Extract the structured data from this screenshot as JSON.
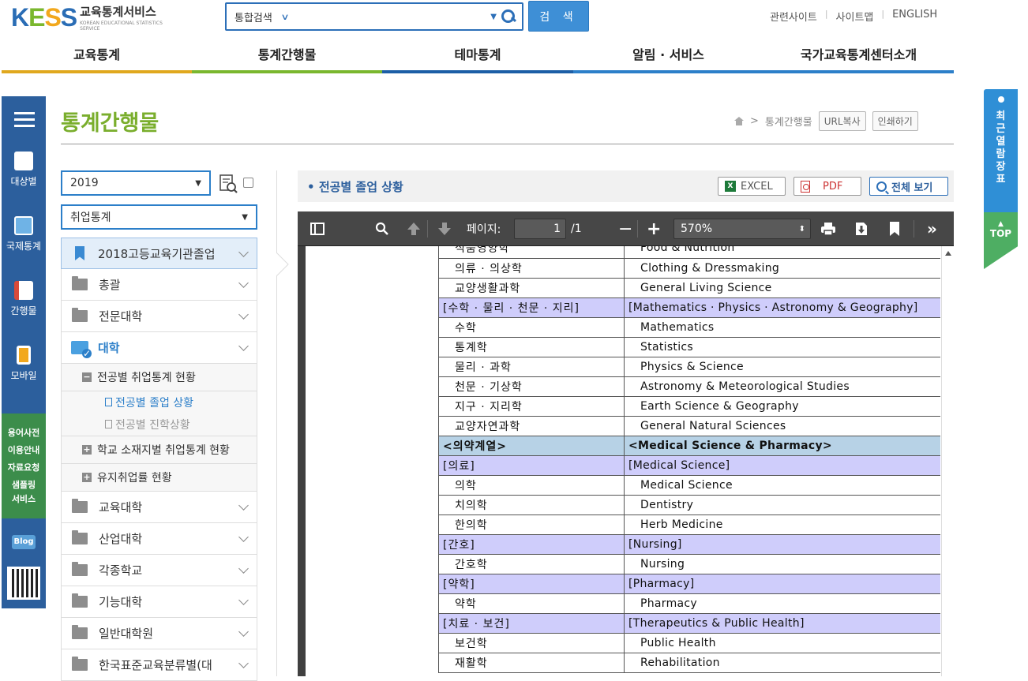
{
  "header": {
    "logo_main": "KESS",
    "logo_ko": "교육통계서비스",
    "logo_en": "KOREAN EDUCATIONAL STATISTICS SERVICE",
    "search_scope": "통합검색",
    "search_button": "검 색",
    "util_links": [
      "관련사이트",
      "사이트맵",
      "ENGLISH"
    ]
  },
  "gnb": {
    "items": [
      "교육통계",
      "통계간행물",
      "테마통계",
      "알림 · 서비스",
      "국가교육통계센터소개"
    ],
    "colors": [
      "#e0a81e",
      "#7ab72e",
      "#1c5ea6",
      "#2c7fc9",
      "#2c7fc9"
    ]
  },
  "quick_nav": {
    "items": [
      "대상별",
      "국제통계",
      "간행물",
      "모바일"
    ],
    "links": [
      "용어사전",
      "이용안내",
      "자료요청",
      "샘플링",
      "서비스"
    ],
    "blog": "Blog"
  },
  "sticky": {
    "recent": "최근열람장표",
    "top": "TOP"
  },
  "page": {
    "title": "통계간행물",
    "breadcrumb": "통계간행물",
    "url_copy": "URL복사",
    "print": "인쇄하기"
  },
  "filters": {
    "year": "2019",
    "category": "취업통계"
  },
  "tree": {
    "first": "2018고등교육기관졸업",
    "folders_top": [
      "총괄",
      "전문대학"
    ],
    "open_folder": "대학",
    "sub1": "전공별 취업통계 현황",
    "leaf1": "전공별 졸업 상황",
    "leaf2": "전공별 진학상황",
    "sub2": "학교 소재지별 취업통계 현황",
    "sub3": "유지취업률 현황",
    "folders_bottom": [
      "교육대학",
      "산업대학",
      "각종학교",
      "기능대학",
      "일반대학원",
      "한국표준교육분류별(대"
    ]
  },
  "viewer": {
    "title": "전공별 졸업 상황",
    "excel": "EXCEL",
    "pdf": "PDF",
    "full": "전체 보기",
    "page_label": "페이지:",
    "page_num": "1",
    "page_total": "/1",
    "zoom": "570%"
  },
  "table_rows": [
    {
      "ko": "식품영양학",
      "en": "Food & Nutrition",
      "type": "row"
    },
    {
      "ko": "의류 · 의상학",
      "en": "Clothing & Dressmaking",
      "type": "row"
    },
    {
      "ko": "교양생활과학",
      "en": "General Living Science",
      "type": "row"
    },
    {
      "ko": "[수학 · 물리 · 천문 · 지리]",
      "en": "[Mathematics · Physics · Astronomy & Geography]",
      "type": "h1"
    },
    {
      "ko": "수학",
      "en": "Mathematics",
      "type": "row"
    },
    {
      "ko": "통계학",
      "en": "Statistics",
      "type": "row"
    },
    {
      "ko": "물리 · 과학",
      "en": "Physics & Science",
      "type": "row"
    },
    {
      "ko": "천문 · 기상학",
      "en": "Astronomy & Meteorological Studies",
      "type": "row"
    },
    {
      "ko": "지구 · 지리학",
      "en": "Earth Science & Geography",
      "type": "row"
    },
    {
      "ko": "교양자연과학",
      "en": "General Natural Sciences",
      "type": "row"
    },
    {
      "ko": "<의약계열>",
      "en": "<Medical Science & Pharmacy>",
      "type": "h0"
    },
    {
      "ko": "[의료]",
      "en": "[Medical Science]",
      "type": "h1"
    },
    {
      "ko": "의학",
      "en": "Medical Science",
      "type": "row"
    },
    {
      "ko": "치의학",
      "en": "Dentistry",
      "type": "row"
    },
    {
      "ko": "한의학",
      "en": "Herb Medicine",
      "type": "row"
    },
    {
      "ko": "[간호]",
      "en": "[Nursing]",
      "type": "h1"
    },
    {
      "ko": "간호학",
      "en": "Nursing",
      "type": "row"
    },
    {
      "ko": "[약학]",
      "en": "[Pharmacy]",
      "type": "h1"
    },
    {
      "ko": "약학",
      "en": "Pharmacy",
      "type": "row"
    },
    {
      "ko": "[치료 · 보건]",
      "en": "[Therapeutics & Public Health]",
      "type": "h1"
    },
    {
      "ko": "보건학",
      "en": "Public Health",
      "type": "row"
    },
    {
      "ko": "재활학",
      "en": "Rehabilitation",
      "type": "row"
    }
  ]
}
